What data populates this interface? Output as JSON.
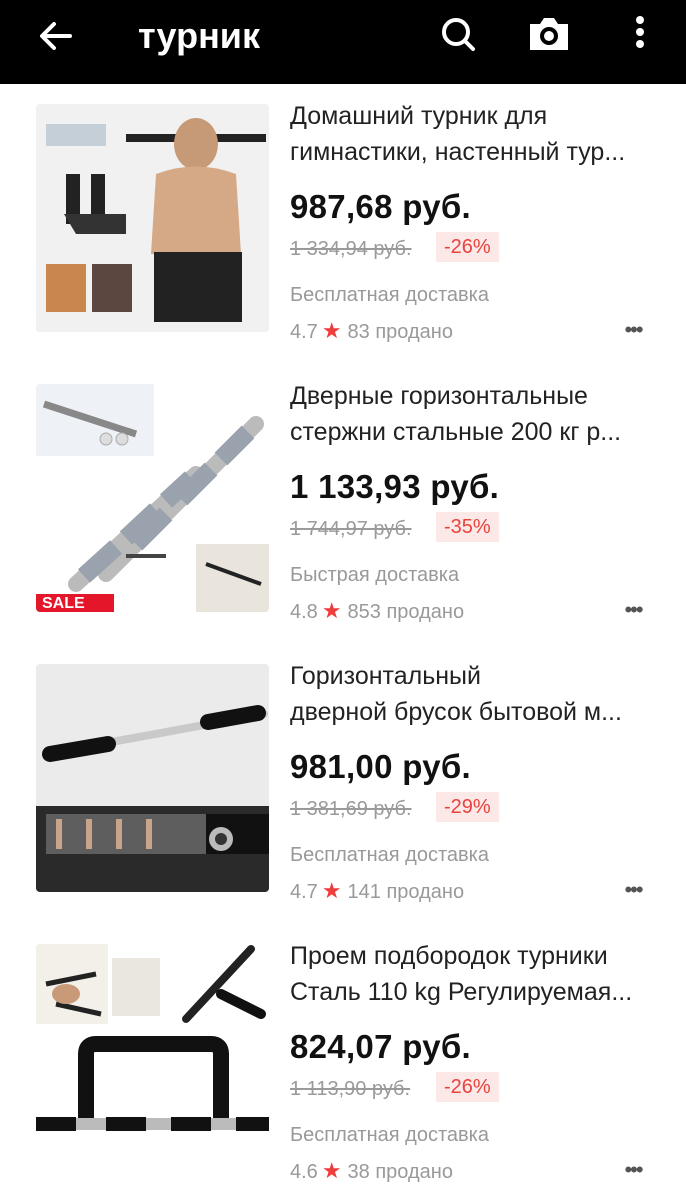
{
  "header": {
    "title": "турник",
    "back_icon": "arrow-left-icon",
    "search_icon": "search-icon",
    "camera_icon": "camera-icon",
    "more_icon": "more-vertical-icon",
    "background": "#000000"
  },
  "colors": {
    "discount_text": "#e8433c",
    "discount_bg": "#fde8e8",
    "star": "#ee3d3d",
    "muted": "#999999"
  },
  "products": [
    {
      "title_line1": "Домашний турник для",
      "title_line2": "гимнастики, настенный тур...",
      "price": "987,68 руб.",
      "old_price": "1 334,94 руб.",
      "discount": "-26%",
      "shipping": "Бесплатная доставка",
      "rating": "4.7",
      "sold": "83 продано"
    },
    {
      "title_line1": "Дверные горизонтальные",
      "title_line2": "стержни стальные 200 кг р...",
      "price": "1 133,93 руб.",
      "old_price": "1 744,97 руб.",
      "discount": "-35%",
      "shipping": "Быстрая доставка",
      "rating": "4.8",
      "sold": "853 продано",
      "image_badge": "SALE"
    },
    {
      "title_line1": "Горизонтальный",
      "title_line2": "дверной брусок бытовой м...",
      "price": "981,00 руб.",
      "old_price": "1 381,69 руб.",
      "discount": "-29%",
      "shipping": "Бесплатная доставка",
      "rating": "4.7",
      "sold": "141 продано"
    },
    {
      "title_line1": "Проем подбородок турники",
      "title_line2": "Сталь 110 kg Регулируемая...",
      "price": "824,07 руб.",
      "old_price": "1 113,90 руб.",
      "discount": "-26%",
      "shipping": "Бесплатная доставка",
      "rating": "4.6",
      "sold": "38 продано"
    }
  ]
}
